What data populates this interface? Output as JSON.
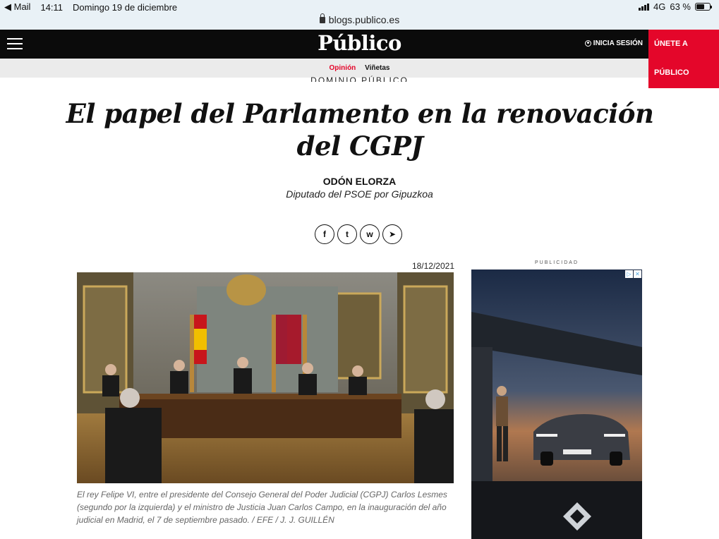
{
  "status_bar": {
    "back_app": "Mail",
    "time": "14:11",
    "date": "Domingo 19 de diciembre",
    "network": "4G",
    "battery": "63 %",
    "battery_level": 0.63
  },
  "browser": {
    "url": "blogs.publico.es"
  },
  "header": {
    "logo": "Público",
    "login": "INICIA SESIÓN",
    "join_line1": "ÚNETE A",
    "join_line2": "PÚBLICO"
  },
  "subnav": {
    "items": [
      {
        "label": "Opinión"
      },
      {
        "label": "Viñetas"
      }
    ]
  },
  "article": {
    "section": "DOMINIO PÚBLICO",
    "title": "El papel del Parlamento en la renovación del CGPJ",
    "author": "ODÓN ELORZA",
    "author_role": "Diputado del PSOE por Gipuzkoa",
    "date": "18/12/2021",
    "caption": "El rey Felipe VI, entre el presidente del Consejo General del Poder Judicial (CGPJ) Carlos Lesmes (segundo por la izquierda) y el ministro de Justicia Juan Carlos Campo, en la inauguración del año judicial en Madrid, el 7 de septiembre pasado. / EFE / J. J. GUILLÉN"
  },
  "share": {
    "facebook": "f",
    "twitter": "t",
    "whatsapp": "w",
    "telegram": "➤"
  },
  "ad": {
    "label": "PUBLICIDAD",
    "badge_info": "▷",
    "badge_close": "✕"
  },
  "colors": {
    "brand_red": "#e4062a",
    "header_bg": "#0b0b0b"
  }
}
